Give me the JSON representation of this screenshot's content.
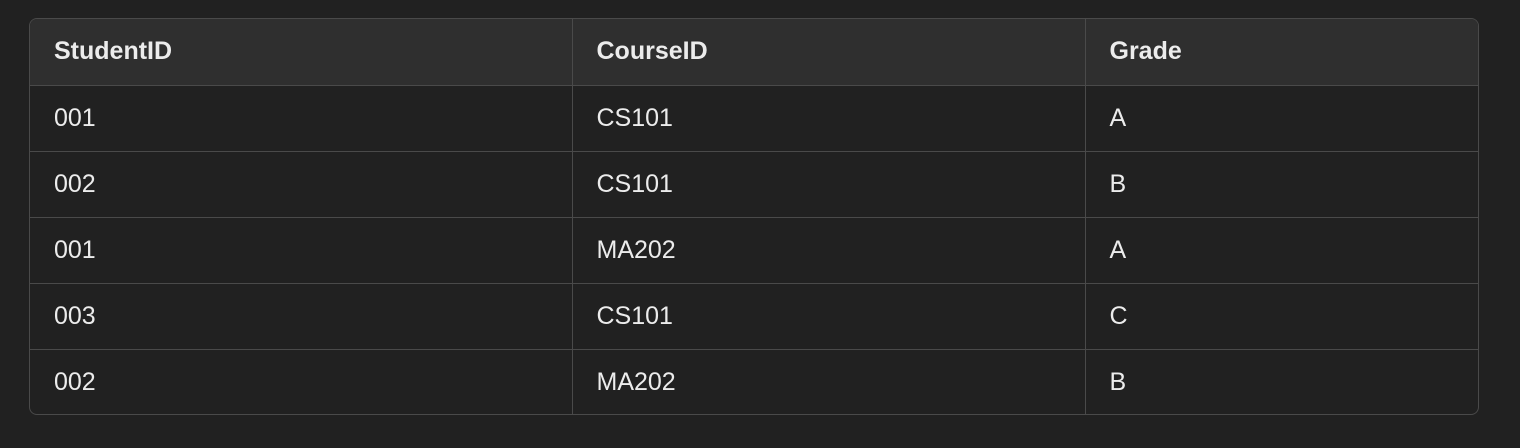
{
  "table": {
    "headers": [
      "StudentID",
      "CourseID",
      "Grade"
    ],
    "rows": [
      [
        "001",
        "CS101",
        "A"
      ],
      [
        "002",
        "CS101",
        "B"
      ],
      [
        "001",
        "MA202",
        "A"
      ],
      [
        "003",
        "CS101",
        "C"
      ],
      [
        "002",
        "MA202",
        "B"
      ]
    ]
  }
}
